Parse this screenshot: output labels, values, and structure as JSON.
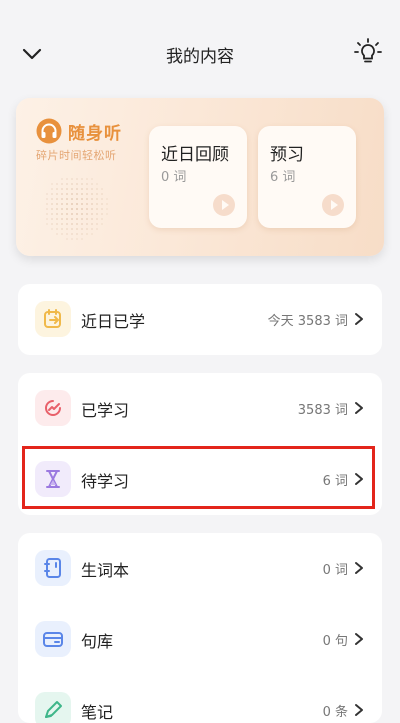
{
  "header": {
    "title": "我的内容",
    "back_icon": "chevron-down-icon",
    "bulb_icon": "lightbulb-icon"
  },
  "hero": {
    "brand_name": "随身听",
    "slogan": "碎片时间轻松听",
    "cards": [
      {
        "title": "近日回顾",
        "subtitle": "0 词"
      },
      {
        "title": "预习",
        "subtitle": "6 词"
      }
    ]
  },
  "groups": [
    [
      {
        "label": "近日已学",
        "value": "今天 3583 词",
        "icon": "calendar-arrow-icon",
        "color": "#f0b94a"
      }
    ],
    [
      {
        "label": "已学习",
        "value": "3583 词",
        "icon": "progress-arc-icon",
        "color": "#e8606a"
      },
      {
        "label": "待学习",
        "value": "6 词",
        "icon": "hourglass-icon",
        "color": "#9b79e0"
      }
    ],
    [
      {
        "label": "生词本",
        "value": "0 词",
        "icon": "notebook-icon",
        "color": "#5a86e8"
      },
      {
        "label": "句库",
        "value": "0 句",
        "icon": "card-icon",
        "color": "#5a86e8"
      },
      {
        "label": "笔记",
        "value": "0 条",
        "icon": "pen-icon",
        "color": "#3fb68a"
      }
    ]
  ],
  "colors": {
    "accent_orange": "#e8913d",
    "highlight_red": "#e3251b"
  }
}
